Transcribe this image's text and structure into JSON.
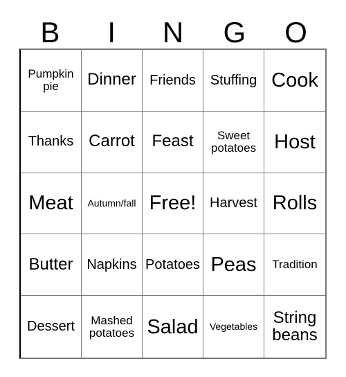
{
  "card": {
    "type": "bingo-card",
    "header_letters": [
      "B",
      "I",
      "N",
      "G",
      "O"
    ],
    "columns": 5,
    "rows": 5,
    "free_space": {
      "row": 3,
      "column": 3,
      "label": "Free!"
    },
    "colors": {
      "background": "#ffffff",
      "text": "#000000",
      "grid_line": "#7a7a7a",
      "outer_border": "#000000"
    },
    "cells": [
      [
        {
          "text": "Pumpkin\npie",
          "size": "s"
        },
        {
          "text": "Dinner",
          "size": "l"
        },
        {
          "text": "Friends",
          "size": "m"
        },
        {
          "text": "Stuffing",
          "size": "m"
        },
        {
          "text": "Cook",
          "size": "xl"
        }
      ],
      [
        {
          "text": "Thanks",
          "size": "m"
        },
        {
          "text": "Carrot",
          "size": "l"
        },
        {
          "text": "Feast",
          "size": "l"
        },
        {
          "text": "Sweet\npotatoes",
          "size": "s"
        },
        {
          "text": "Host",
          "size": "xl"
        }
      ],
      [
        {
          "text": "Meat",
          "size": "xl"
        },
        {
          "text": "Autumn/fall",
          "size": "xs"
        },
        {
          "text": "Free!",
          "size": "xl"
        },
        {
          "text": "Harvest",
          "size": "m"
        },
        {
          "text": "Rolls",
          "size": "xl"
        }
      ],
      [
        {
          "text": "Butter",
          "size": "l"
        },
        {
          "text": "Napkins",
          "size": "m"
        },
        {
          "text": "Potatoes",
          "size": "m"
        },
        {
          "text": "Peas",
          "size": "xl"
        },
        {
          "text": "Tradition",
          "size": "s"
        }
      ],
      [
        {
          "text": "Dessert",
          "size": "m"
        },
        {
          "text": "Mashed\npotatoes",
          "size": "s"
        },
        {
          "text": "Salad",
          "size": "xl"
        },
        {
          "text": "Vegetables",
          "size": "xs"
        },
        {
          "text": "String\nbeans",
          "size": "l"
        }
      ]
    ]
  }
}
